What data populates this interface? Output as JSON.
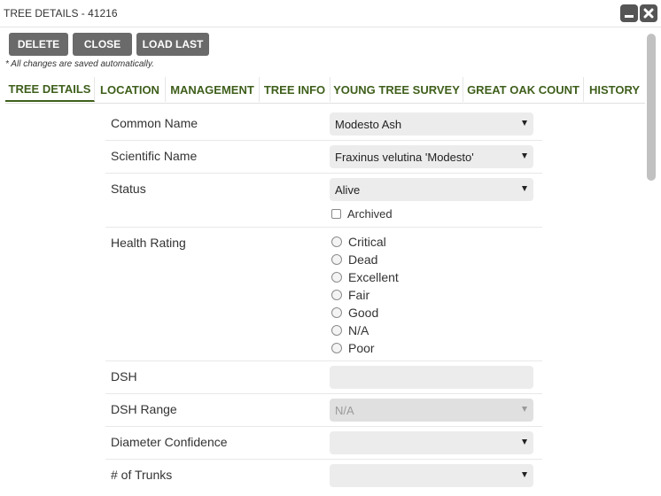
{
  "window": {
    "title": "TREE DETAILS - 41216",
    "minimize_icon": "minimize-icon",
    "close_icon": "close-icon"
  },
  "toolbar": {
    "delete_label": "DELETE",
    "close_label": "CLOSE",
    "load_last_label": "LOAD LAST"
  },
  "note": "* All changes are saved automatically.",
  "tabs": [
    {
      "label": "TREE DETAILS",
      "active": true
    },
    {
      "label": "LOCATION"
    },
    {
      "label": "MANAGEMENT"
    },
    {
      "label": "TREE INFO"
    },
    {
      "label": "YOUNG TREE SURVEY"
    },
    {
      "label": "GREAT OAK COUNT"
    },
    {
      "label": "HISTORY"
    }
  ],
  "form": {
    "common_name": {
      "label": "Common Name",
      "value": "Modesto Ash"
    },
    "scientific_name": {
      "label": "Scientific Name",
      "value": "Fraxinus velutina 'Modesto'"
    },
    "status": {
      "label": "Status",
      "value": "Alive",
      "archived_label": "Archived",
      "archived_checked": false
    },
    "health_rating": {
      "label": "Health Rating",
      "options": [
        "Critical",
        "Dead",
        "Excellent",
        "Fair",
        "Good",
        "N/A",
        "Poor"
      ],
      "selected": null
    },
    "dsh": {
      "label": "DSH",
      "value": ""
    },
    "dsh_range": {
      "label": "DSH Range",
      "value": "N/A"
    },
    "diameter_confidence": {
      "label": "Diameter Confidence",
      "value": ""
    },
    "num_trunks": {
      "label": "# of Trunks",
      "value": ""
    }
  },
  "colors": {
    "tab_text": "#3f5f1b",
    "button_bg": "#6a6a6a",
    "field_bg": "#ececec"
  }
}
